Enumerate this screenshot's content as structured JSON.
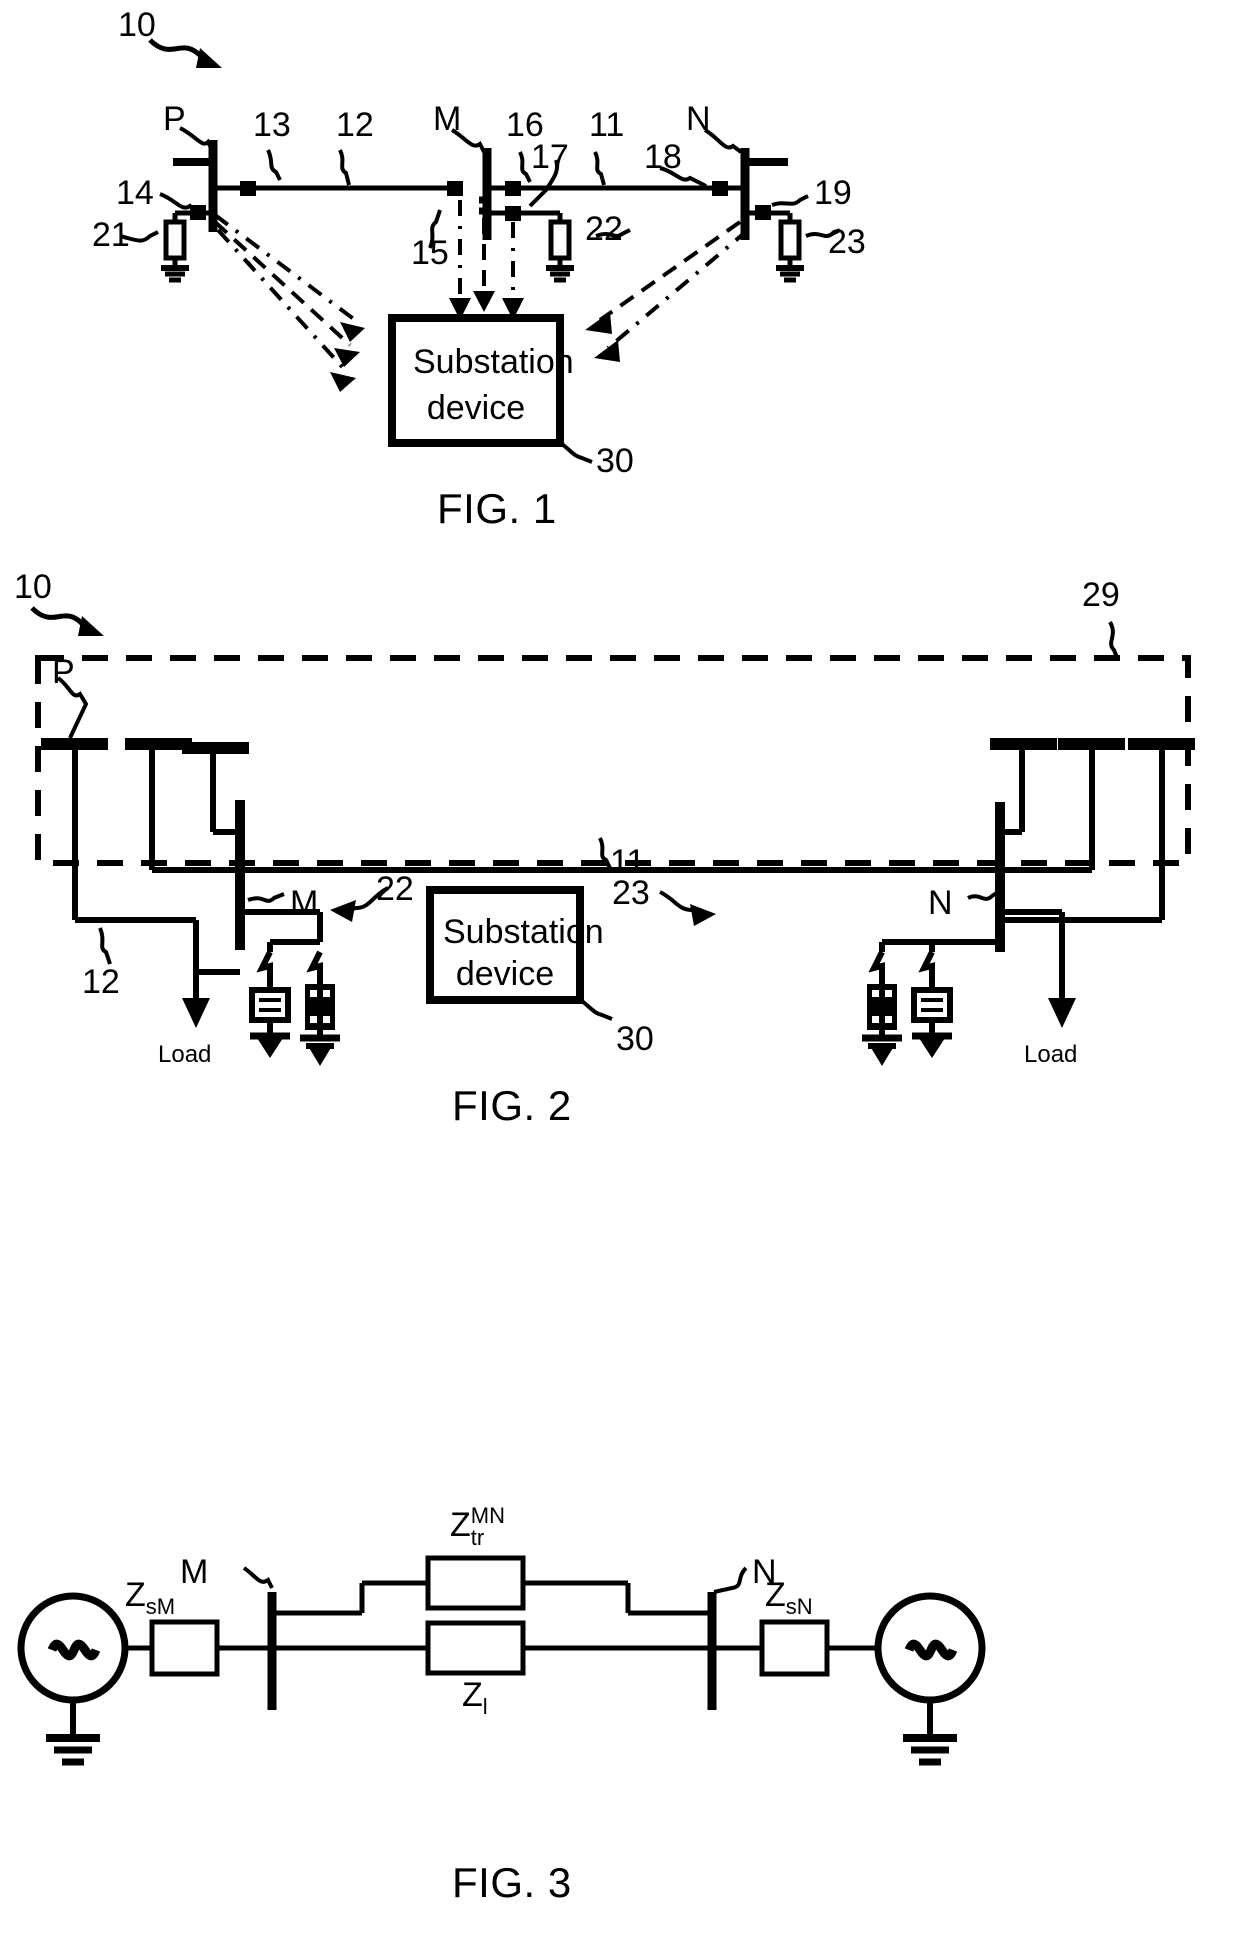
{
  "document": {
    "type": "patent-drawing-sheet",
    "figures": [
      "FIG. 1",
      "FIG. 2",
      "FIG. 3"
    ]
  },
  "fig1": {
    "caption": "FIG. 1",
    "system_ref": "10",
    "bus_labels": {
      "p": "P",
      "m": "M",
      "n": "N"
    },
    "reference_numerals": {
      "n11": "11",
      "n12": "12",
      "n13": "13",
      "n14": "14",
      "n15": "15",
      "n16": "16",
      "n17": "17",
      "n18": "18",
      "n19": "19",
      "n21": "21",
      "n22": "22",
      "n23": "23",
      "n30": "30"
    },
    "substation_box": {
      "line1": "Substation",
      "line2": "device",
      "ref": "30"
    }
  },
  "fig2": {
    "caption": "FIG. 2",
    "system_ref": "10",
    "boundary_ref": "29",
    "bus_labels": {
      "p": "P",
      "m": "M",
      "n": "N"
    },
    "reference_numerals": {
      "n11": "11",
      "n12": "12",
      "n22": "22",
      "n23": "23",
      "n29": "29",
      "n30": "30"
    },
    "load_left": "Load",
    "load_right": "Load",
    "substation_box": {
      "line1": "Substation",
      "line2": "device",
      "ref": "30"
    }
  },
  "fig3": {
    "caption": "FIG. 3",
    "bus_labels": {
      "m": "M",
      "n": "N"
    },
    "impedances": [
      {
        "id": "zsm",
        "base": "Z",
        "sub": "sM",
        "sup": ""
      },
      {
        "id": "ztr",
        "base": "Z",
        "sub": "tr",
        "sup": "MN"
      },
      {
        "id": "zl",
        "base": "Z",
        "sub": "l",
        "sup": ""
      },
      {
        "id": "zsn",
        "base": "Z",
        "sub": "sN",
        "sup": ""
      }
    ],
    "source_symbol": "~"
  },
  "colors": {
    "ink": "#000000",
    "paper": "#ffffff"
  }
}
